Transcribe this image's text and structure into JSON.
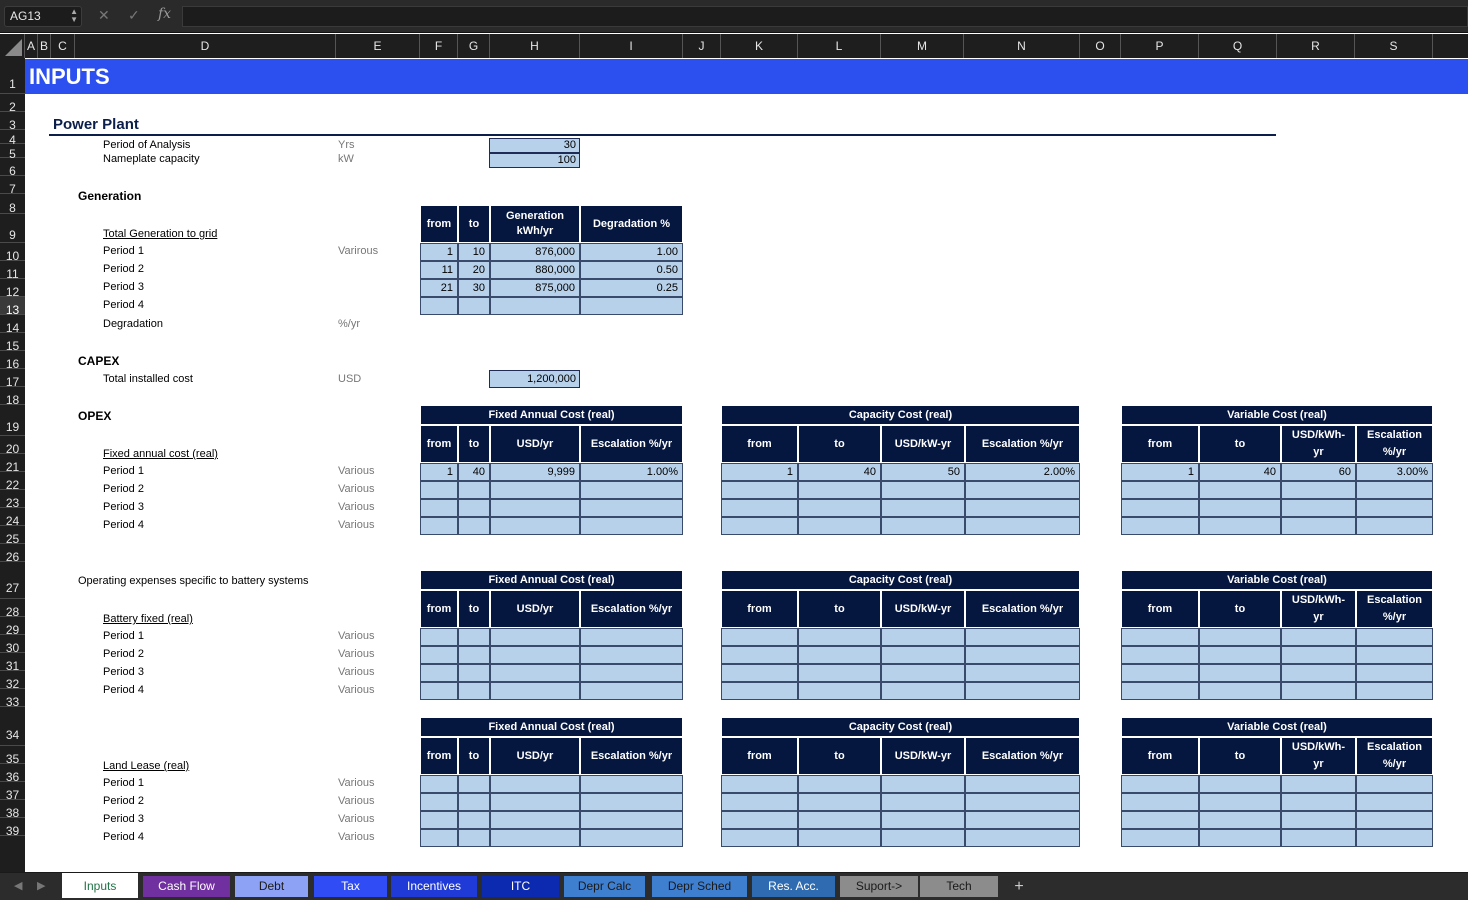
{
  "formula_bar": {
    "cell_ref": "AG13",
    "formula": "",
    "fx_label": "fx"
  },
  "columns": [
    "A",
    "B",
    "C",
    "D",
    "E",
    "F",
    "G",
    "H",
    "I",
    "J",
    "K",
    "L",
    "M",
    "N",
    "O",
    "P",
    "Q",
    "R",
    "S"
  ],
  "rows": [
    "1",
    "2",
    "3",
    "4",
    "5",
    "6",
    "7",
    "8",
    "9",
    "10",
    "11",
    "12",
    "13",
    "14",
    "15",
    "16",
    "17",
    "18",
    "19",
    "20",
    "21",
    "22",
    "23",
    "24",
    "25",
    "26",
    "27",
    "28",
    "29",
    "30",
    "31",
    "32",
    "33",
    "34",
    "35",
    "36",
    "37",
    "38",
    "39"
  ],
  "active_row": "13",
  "sheet": {
    "banner": "INPUTS",
    "section_power_plant": "Power Plant",
    "period_of_analysis": {
      "label": "Period of Analysis",
      "unit": "Yrs",
      "value": "30"
    },
    "nameplate": {
      "label": "Nameplate capacity",
      "unit": "kW",
      "value": "100"
    },
    "generation_heading": "Generation",
    "total_generation": "Total Generation to grid",
    "gen_unit": "Varirous",
    "gen_table_headers": [
      "from",
      "to",
      "Generation kWh/yr",
      "Degradation %"
    ],
    "gen_rows": [
      {
        "label": "Period 1",
        "from": "1",
        "to": "10",
        "gen": "876,000",
        "deg": "1.00"
      },
      {
        "label": "Period 2",
        "from": "11",
        "to": "20",
        "gen": "880,000",
        "deg": "0.50"
      },
      {
        "label": "Period 3",
        "from": "21",
        "to": "30",
        "gen": "875,000",
        "deg": "0.25"
      },
      {
        "label": "Period 4",
        "from": "",
        "to": "",
        "gen": "",
        "deg": ""
      }
    ],
    "degradation": {
      "label": "Degradation",
      "unit": "%/yr"
    },
    "capex_heading": "CAPEX",
    "capex": {
      "label": "Total installed cost",
      "unit": "USD",
      "value": "1,200,000"
    },
    "opex_heading": "OPEX",
    "battery_heading": "Operating expenses specific to battery systems",
    "blocks": [
      {
        "label": "Fixed annual cost (real)",
        "rows": [
          {
            "label": "Period 1",
            "unit": "Various"
          },
          {
            "label": "Period 2",
            "unit": "Various"
          },
          {
            "label": "Period 3",
            "unit": "Various"
          },
          {
            "label": "Period 4",
            "unit": "Various"
          }
        ]
      },
      {
        "label": "Battery fixed (real)",
        "rows": [
          {
            "label": "Period 1",
            "unit": "Various"
          },
          {
            "label": "Period 2",
            "unit": "Various"
          },
          {
            "label": "Period 3",
            "unit": "Various"
          },
          {
            "label": "Period 4",
            "unit": "Various"
          }
        ]
      },
      {
        "label": "Land Lease (real)",
        "rows": [
          {
            "label": "Period 1",
            "unit": "Various"
          },
          {
            "label": "Period 2",
            "unit": "Various"
          },
          {
            "label": "Period 3",
            "unit": "Various"
          },
          {
            "label": "Period 4",
            "unit": "Various"
          }
        ]
      }
    ],
    "cost_tables": {
      "fixed": {
        "title": "Fixed Annual Cost (real)",
        "headers": [
          "from",
          "to",
          "USD/yr",
          "Escalation %/yr"
        ]
      },
      "capacity": {
        "title": "Capacity Cost (real)",
        "headers": [
          "from",
          "to",
          "USD/kW-yr",
          "Escalation %/yr"
        ]
      },
      "variable": {
        "title": "Variable Cost (real)",
        "headers": [
          "from",
          "to",
          "USD/kWh-yr",
          "Escalation %/yr"
        ]
      }
    },
    "opex_values": {
      "fixed": [
        "1",
        "40",
        "9,999",
        "1.00%"
      ],
      "capacity": [
        "1",
        "40",
        "50",
        "2.00%"
      ],
      "variable": [
        "1",
        "40",
        "60",
        "3.00%"
      ]
    }
  },
  "tabs": [
    {
      "label": "Inputs",
      "color": "#ffffff",
      "text": "#217346"
    },
    {
      "label": "Cash Flow",
      "color": "#7030a0",
      "text": "#ffffff"
    },
    {
      "label": "Debt",
      "color": "#8ea2f5",
      "text": "#1a1a1a"
    },
    {
      "label": "Tax",
      "color": "#2f4cf5",
      "text": "#ffffff"
    },
    {
      "label": "Incentives",
      "color": "#1f3ad6",
      "text": "#ffffff"
    },
    {
      "label": "ITC",
      "color": "#0b2ab0",
      "text": "#ffffff"
    },
    {
      "label": "Depr Calc",
      "color": "#3f7fcf",
      "text": "#1a1a1a"
    },
    {
      "label": "Depr Sched",
      "color": "#3f7fcf",
      "text": "#1a1a1a"
    },
    {
      "label": "Res. Acc.",
      "color": "#2e6bb0",
      "text": "#ffffff"
    },
    {
      "label": "Suport->",
      "color": "#8c8c8c",
      "text": "#1a1a1a"
    },
    {
      "label": "Tech",
      "color": "#8c8c8c",
      "text": "#1a1a1a"
    }
  ],
  "add_tab": "+",
  "colors": {
    "banner": "#2c4ff0",
    "header_fill": "#05163f",
    "input_fill": "#b8d1ea"
  }
}
